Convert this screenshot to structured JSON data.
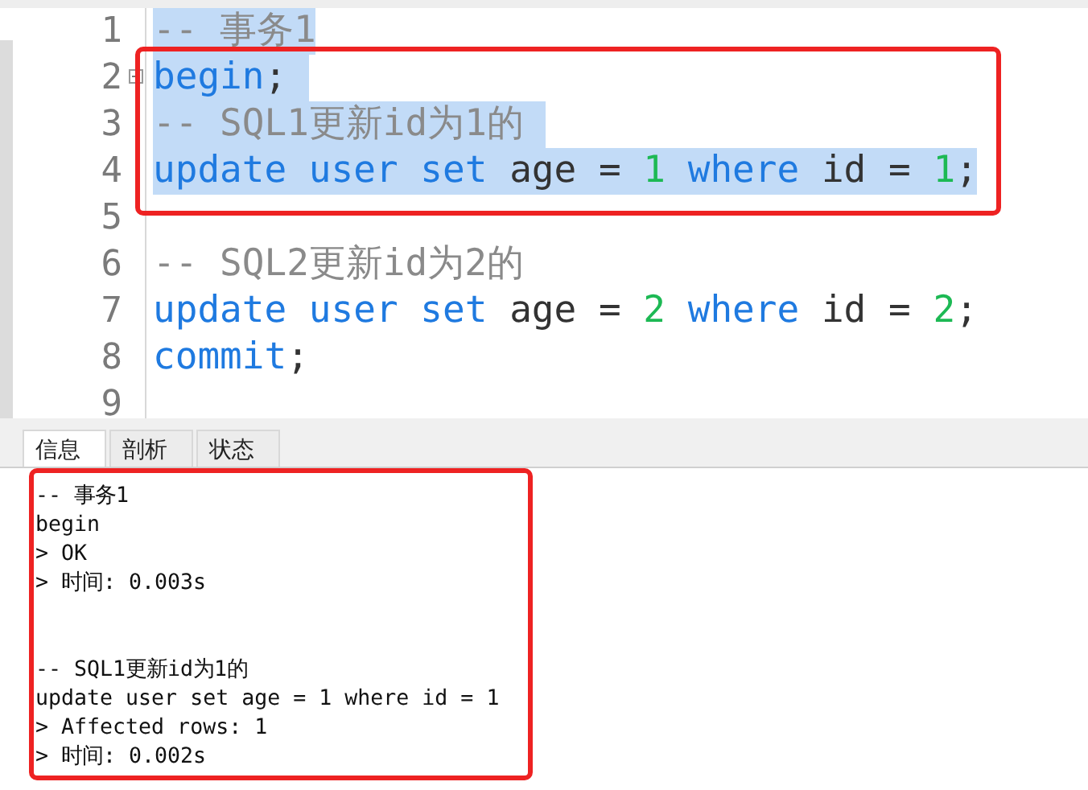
{
  "editor": {
    "lines": [
      {
        "number": "1",
        "selected": true,
        "boxed": false,
        "fold": false,
        "tokens": [
          {
            "kind": "comment",
            "text": "-- 事务1"
          }
        ]
      },
      {
        "number": "2",
        "selected": true,
        "boxed": true,
        "fold": true,
        "tokens": [
          {
            "kind": "keyword",
            "text": "begin"
          },
          {
            "kind": "plain",
            "text": "; "
          }
        ]
      },
      {
        "number": "3",
        "selected": true,
        "boxed": true,
        "fold": false,
        "tokens": [
          {
            "kind": "comment",
            "text": "-- SQL1更新id为1的 "
          }
        ]
      },
      {
        "number": "4",
        "selected": true,
        "boxed": true,
        "fold": false,
        "tokens": [
          {
            "kind": "keyword",
            "text": "update user set"
          },
          {
            "kind": "plain",
            "text": " age = "
          },
          {
            "kind": "number",
            "text": "1"
          },
          {
            "kind": "keyword",
            "text": " where"
          },
          {
            "kind": "plain",
            "text": " id = "
          },
          {
            "kind": "number",
            "text": "1"
          },
          {
            "kind": "plain",
            "text": ";"
          }
        ]
      },
      {
        "number": "5",
        "selected": false,
        "boxed": false,
        "fold": false
      },
      {
        "number": "6",
        "selected": false,
        "boxed": false,
        "fold": false,
        "tokens": [
          {
            "kind": "comment",
            "text": "-- SQL2更新id为2的"
          }
        ]
      },
      {
        "number": "7",
        "selected": false,
        "boxed": false,
        "fold": false,
        "tokens": [
          {
            "kind": "keyword",
            "text": "update user set"
          },
          {
            "kind": "plain",
            "text": " age = "
          },
          {
            "kind": "number",
            "text": "2"
          },
          {
            "kind": "keyword",
            "text": " where"
          },
          {
            "kind": "plain",
            "text": " id = "
          },
          {
            "kind": "number",
            "text": "2"
          },
          {
            "kind": "plain",
            "text": ";"
          }
        ]
      },
      {
        "number": "8",
        "selected": false,
        "boxed": false,
        "fold": false,
        "tokens": [
          {
            "kind": "keyword",
            "text": "commit"
          },
          {
            "kind": "plain",
            "text": ";"
          }
        ]
      },
      {
        "number": "9",
        "selected": false,
        "boxed": false,
        "fold": false
      }
    ]
  },
  "tabs": [
    {
      "label": "信息",
      "selected": true
    },
    {
      "label": "剖析",
      "selected": false
    },
    {
      "label": "状态",
      "selected": false
    }
  ],
  "output": {
    "boxed": true,
    "blocks": [
      {
        "lines": [
          "-- 事务1",
          "begin",
          "> OK",
          "> 时间: 0.003s"
        ]
      },
      {
        "lines": [
          "-- SQL1更新id为1的",
          "update user set age = 1 where id = 1",
          "> Affected rows: 1",
          "> 时间: 0.002s"
        ]
      }
    ]
  }
}
